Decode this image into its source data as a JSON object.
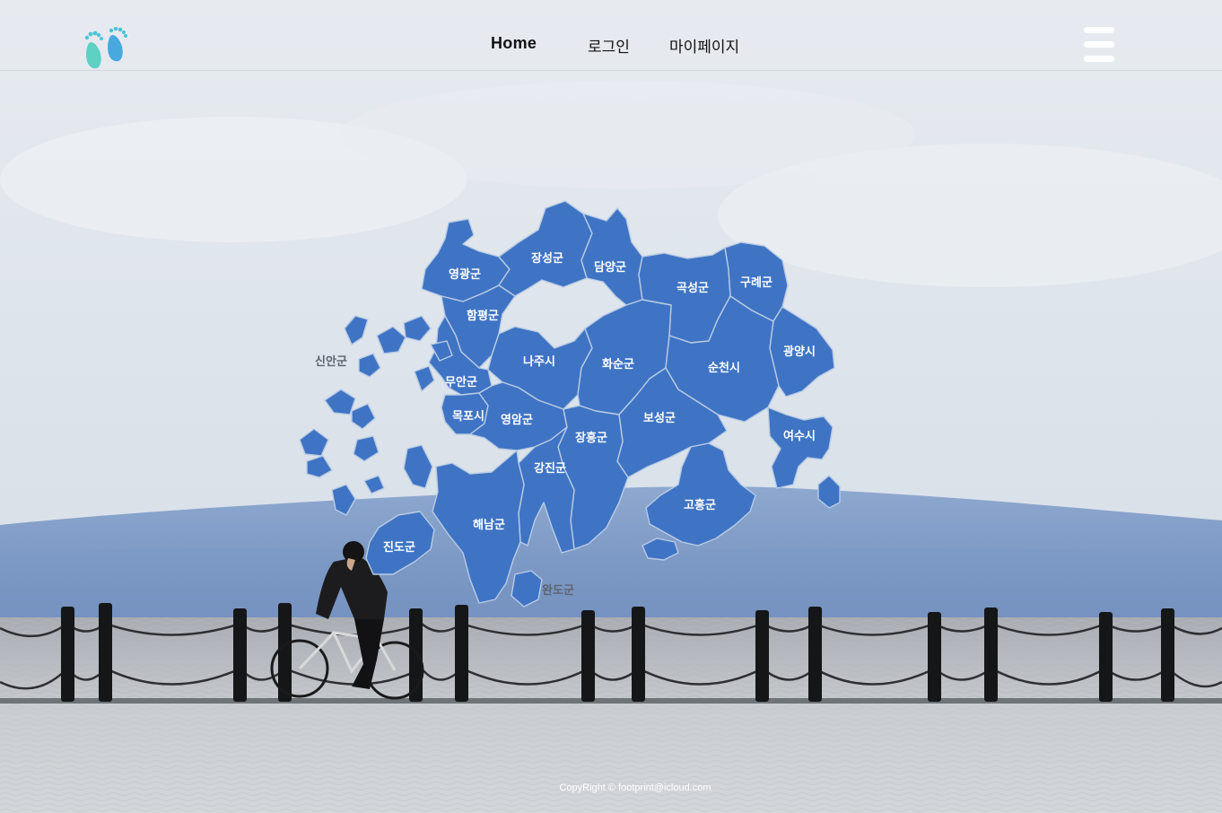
{
  "nav": {
    "home_label": "Home",
    "login_label": "로그인",
    "mypage_label": "마이페이지"
  },
  "map": {
    "fill_color": "#3f74c4",
    "label_color": "#ffffff",
    "outside_label_color": "#5c6470",
    "regions": [
      {
        "id": "yeonggwang",
        "label": "영광군"
      },
      {
        "id": "jangseong",
        "label": "장성군"
      },
      {
        "id": "damyang",
        "label": "담양군"
      },
      {
        "id": "gokseong",
        "label": "곡성군"
      },
      {
        "id": "gurye",
        "label": "구례군"
      },
      {
        "id": "hampyeong",
        "label": "함평군"
      },
      {
        "id": "sinan",
        "label": "신안군"
      },
      {
        "id": "naju",
        "label": "나주시"
      },
      {
        "id": "hwasun",
        "label": "화순군"
      },
      {
        "id": "suncheon",
        "label": "순천시"
      },
      {
        "id": "gwangyang",
        "label": "광양시"
      },
      {
        "id": "muan",
        "label": "무안군"
      },
      {
        "id": "mokpo",
        "label": "목포시"
      },
      {
        "id": "yeongam",
        "label": "영암군"
      },
      {
        "id": "boseong",
        "label": "보성군"
      },
      {
        "id": "jangheung",
        "label": "장흥군"
      },
      {
        "id": "yeosu",
        "label": "여수시"
      },
      {
        "id": "gangjin",
        "label": "강진군"
      },
      {
        "id": "goheung",
        "label": "고흥군"
      },
      {
        "id": "haenam",
        "label": "해남군"
      },
      {
        "id": "jindo",
        "label": "진도군"
      },
      {
        "id": "wando",
        "label": "완도군"
      }
    ]
  },
  "footer": {
    "copyright": "CopyRight © footprint@icloud.com"
  },
  "icons": {
    "logo": "footprints-logo-icon",
    "menu": "hamburger-menu-icon"
  }
}
